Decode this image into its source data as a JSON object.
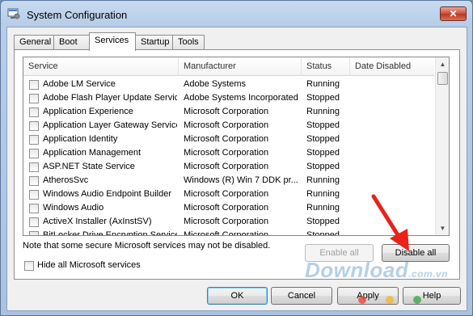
{
  "window": {
    "title": "System Configuration",
    "close_glyph": "✕"
  },
  "tabs": [
    {
      "label": "General",
      "active": false
    },
    {
      "label": "Boot",
      "active": false
    },
    {
      "label": "Services",
      "active": true
    },
    {
      "label": "Startup",
      "active": false
    },
    {
      "label": "Tools",
      "active": false
    }
  ],
  "columns": {
    "service": "Service",
    "manufacturer": "Manufacturer",
    "status": "Status",
    "date_disabled": "Date Disabled"
  },
  "services": [
    {
      "name": "Adobe LM Service",
      "manufacturer": "Adobe Systems",
      "status": "Running",
      "date_disabled": ""
    },
    {
      "name": "Adobe Flash Player Update Service",
      "manufacturer": "Adobe Systems Incorporated",
      "status": "Stopped",
      "date_disabled": ""
    },
    {
      "name": "Application Experience",
      "manufacturer": "Microsoft Corporation",
      "status": "Running",
      "date_disabled": ""
    },
    {
      "name": "Application Layer Gateway Service",
      "manufacturer": "Microsoft Corporation",
      "status": "Stopped",
      "date_disabled": ""
    },
    {
      "name": "Application Identity",
      "manufacturer": "Microsoft Corporation",
      "status": "Stopped",
      "date_disabled": ""
    },
    {
      "name": "Application Management",
      "manufacturer": "Microsoft Corporation",
      "status": "Stopped",
      "date_disabled": ""
    },
    {
      "name": "ASP.NET State Service",
      "manufacturer": "Microsoft Corporation",
      "status": "Stopped",
      "date_disabled": ""
    },
    {
      "name": "AtherosSvc",
      "manufacturer": "Windows (R) Win 7 DDK pr...",
      "status": "Running",
      "date_disabled": ""
    },
    {
      "name": "Windows Audio Endpoint Builder",
      "manufacturer": "Microsoft Corporation",
      "status": "Running",
      "date_disabled": ""
    },
    {
      "name": "Windows Audio",
      "manufacturer": "Microsoft Corporation",
      "status": "Running",
      "date_disabled": ""
    },
    {
      "name": "ActiveX Installer (AxInstSV)",
      "manufacturer": "Microsoft Corporation",
      "status": "Stopped",
      "date_disabled": ""
    },
    {
      "name": "BitLocker Drive Encryption Service",
      "manufacturer": "Microsoft Corporation",
      "status": "Stopped",
      "date_disabled": ""
    }
  ],
  "note": "Note that some secure Microsoft services may not be disabled.",
  "buttons": {
    "enable_all": "Enable all",
    "disable_all": "Disable all",
    "ok": "OK",
    "cancel": "Cancel",
    "apply": "Apply",
    "help": "Help"
  },
  "hide_ms_services": {
    "label": "Hide all Microsoft services",
    "checked": false
  },
  "watermark": {
    "main": "Download",
    "suffix": ".com.vn"
  },
  "colors": {
    "annotation_arrow": "#e8231b"
  },
  "icons": {
    "scroll_up": "▲",
    "scroll_down": "▼"
  }
}
